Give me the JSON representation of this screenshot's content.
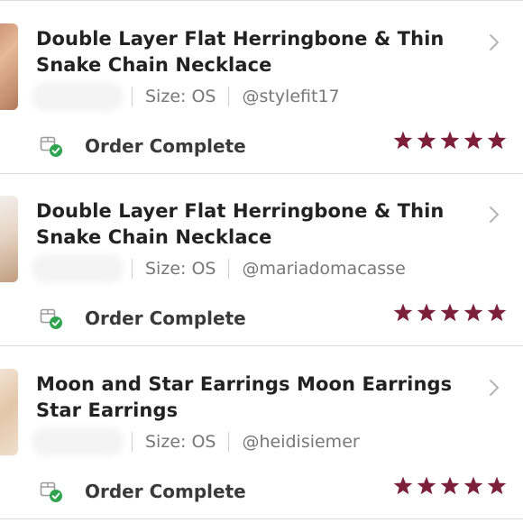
{
  "colors": {
    "star": "#7b1f3a",
    "check": "#2ea44f",
    "separator": "#d9d9d9",
    "title": "#222222",
    "meta": "#777777"
  },
  "orders": [
    {
      "title_line1": "Double Layer Flat Herringbone & Thin",
      "title_line2": "Snake Chain Necklace",
      "size_label": "Size: OS",
      "seller": "@stylefit17",
      "status": "Order Complete",
      "rating": 5,
      "icon": "box-check-icon"
    },
    {
      "title_line1": "Double Layer Flat Herringbone & Thin",
      "title_line2": "Snake Chain Necklace",
      "size_label": "Size: OS",
      "seller": "@mariadomacasse",
      "status": "Order Complete",
      "rating": 5,
      "icon": "box-check-icon"
    },
    {
      "title_line1": "Moon and Star Earrings Moon Earrings",
      "title_line2": "Star Earrings",
      "size_label": "Size: OS",
      "seller": "@heidisiemer",
      "status": "Order Complete",
      "rating": 5,
      "icon": "box-check-icon"
    }
  ]
}
